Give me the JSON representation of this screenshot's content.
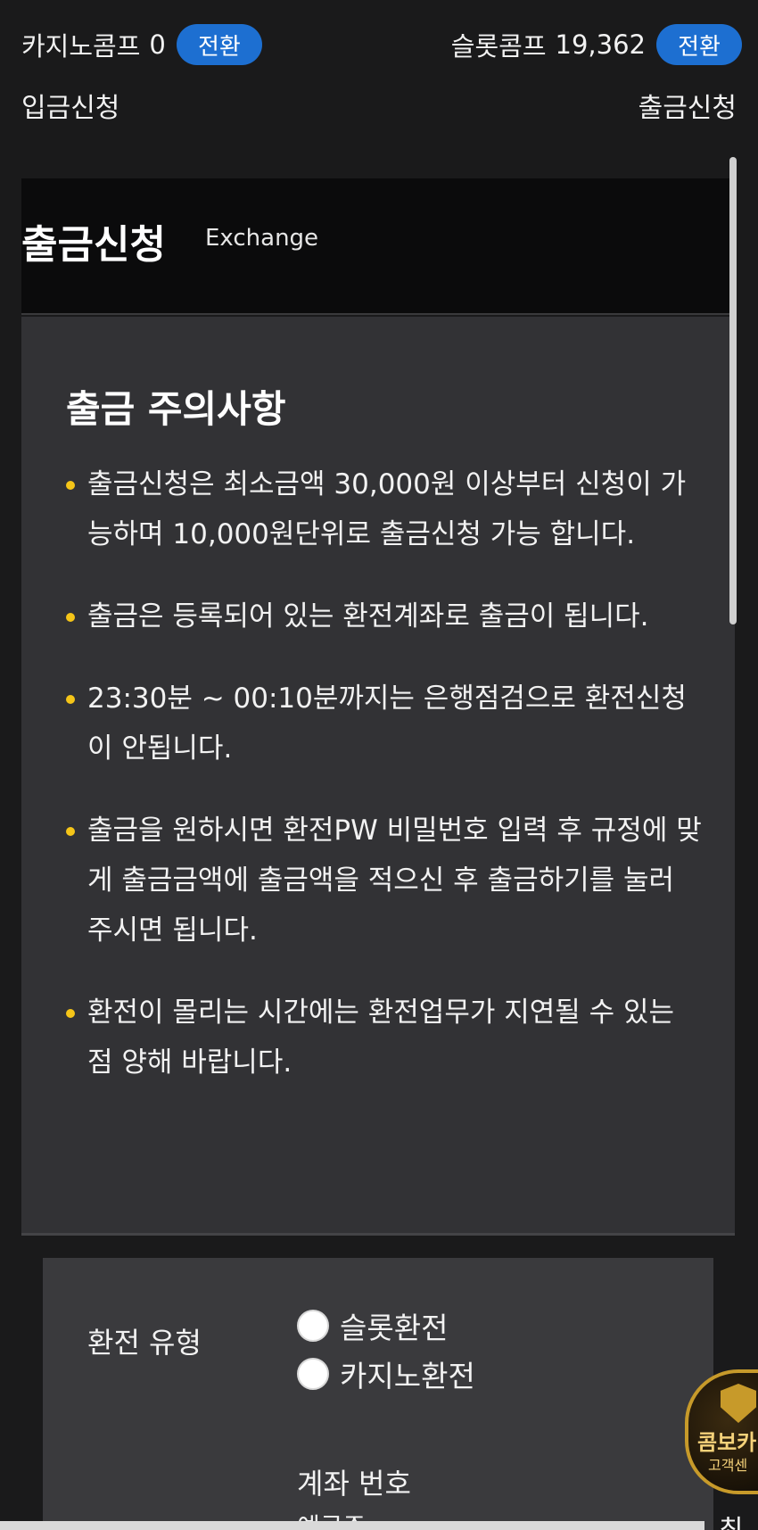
{
  "topbar": {
    "casino_comp_label": "카지노콤프",
    "casino_comp_value": "0",
    "slot_comp_label": "슬롯콤프",
    "slot_comp_value": "19,362",
    "switch_label": "전환",
    "deposit_link": "입금신청",
    "withdraw_link": "출금신청"
  },
  "header": {
    "title": "출금신청",
    "subtitle": "Exchange"
  },
  "notice": {
    "title": "출금 주의사항",
    "items": [
      "출금신청은 최소금액 30,000원 이상부터 신청이 가능하며 10,000원단위로 출금신청 가능 합니다.",
      "출금은 등록되어 있는 환전계좌로 출금이 됩니다.",
      "23:30분 ~ 00:10분까지는 은행점검으로 환전신청이 안됩니다.",
      "출금을 원하시면 환전PW 비밀번호 입력 후 규정에 맞게 출금금액에 출금액을 적으신 후 출금하기를 눌러 주시면 됩니다.",
      "환전이 몰리는 시간에는 환전업무가 지연될 수 있는 점 양해 바랍니다."
    ]
  },
  "form": {
    "type_label": "환전 유형",
    "option_slot": "슬롯환전",
    "option_casino": "카지노환전",
    "account_label": "계좌 번호",
    "account_sub": "예금주"
  },
  "support_badge": {
    "text": "콤보카",
    "sub": "고객센"
  },
  "bottom_right": "최"
}
